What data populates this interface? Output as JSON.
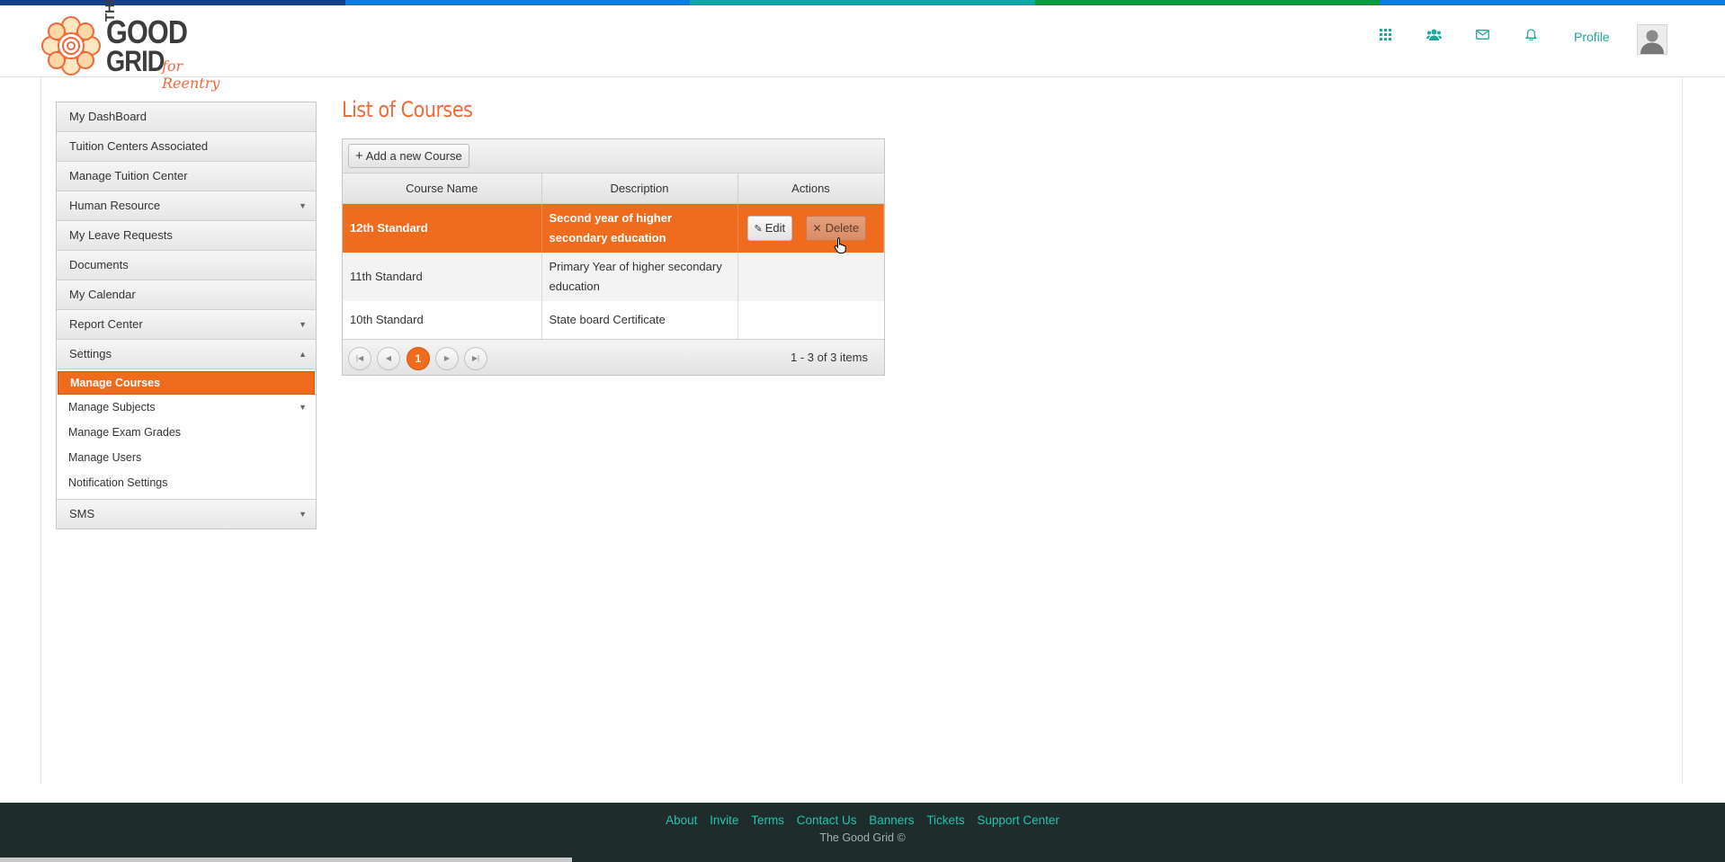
{
  "logo": {
    "line1": "THE",
    "line2": "GOOD",
    "line3": "GRID",
    "tagline": "for Reentry"
  },
  "header": {
    "icons": [
      "apps-grid-icon",
      "users-icon",
      "mail-icon",
      "bell-icon"
    ],
    "profile_label": "Profile"
  },
  "colors": {
    "accent": "#ef6b1d",
    "teal": "#1fa89a",
    "footer_bg": "#1e2c2b",
    "title": "#ef6a3a"
  },
  "sidebar": {
    "items": [
      {
        "label": "My DashBoard"
      },
      {
        "label": "Tuition Centers Associated"
      },
      {
        "label": "Manage Tuition Center"
      },
      {
        "label": "Human Resource",
        "caret": "▼"
      },
      {
        "label": "My Leave Requests"
      },
      {
        "label": "Documents"
      },
      {
        "label": "My Calendar"
      },
      {
        "label": "Report Center",
        "caret": "▼"
      },
      {
        "label": "Settings",
        "caret": "▲"
      }
    ],
    "settings_sub": [
      {
        "label": "Manage Courses"
      },
      {
        "label": "Manage Subjects",
        "caret": "▼"
      },
      {
        "label": "Manage Exam Grades"
      },
      {
        "label": "Manage Users"
      },
      {
        "label": "Notification Settings"
      }
    ],
    "last": {
      "label": "SMS",
      "caret": "▼"
    }
  },
  "main": {
    "title": "List of Courses",
    "add_button": "Add a new Course",
    "columns": [
      "Course Name",
      "Description",
      "Actions"
    ],
    "rows": [
      {
        "name": "12th Standard",
        "desc": "Second year of higher secondary education"
      },
      {
        "name": "11th Standard",
        "desc": "Primary Year of higher secondary education"
      },
      {
        "name": "10th Standard",
        "desc": "State board Certificate"
      }
    ],
    "edit_label": "Edit",
    "delete_label": "Delete",
    "pager": {
      "current": "1",
      "info": "1 - 3 of 3 items"
    }
  },
  "footer": {
    "links": [
      "About",
      "Invite",
      "Terms",
      "Contact Us",
      "Banners",
      "Tickets",
      "Support Center"
    ],
    "copyright": "The Good Grid ©"
  }
}
